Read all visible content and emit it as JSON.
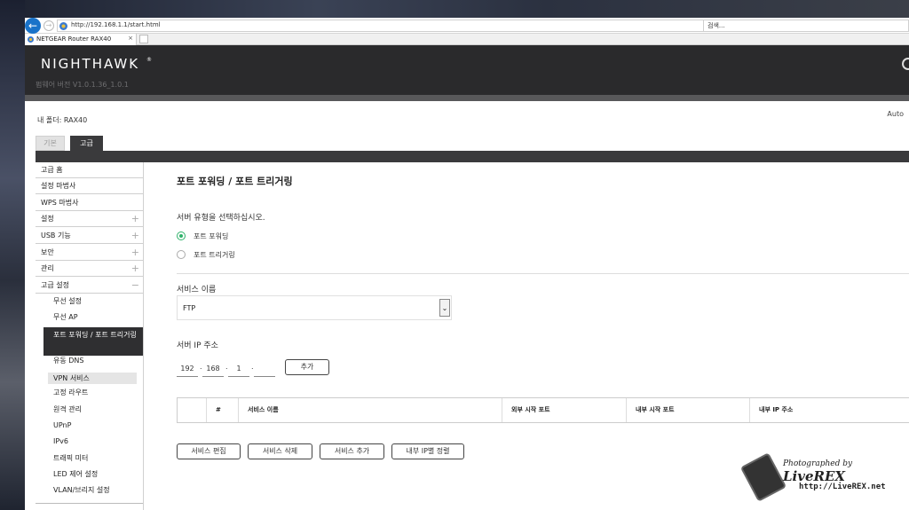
{
  "browser": {
    "url": "http://192.168.1.1/start.html",
    "url_tools": "▾ ↻",
    "search_placeholder": "검색...",
    "tab_title": "NETGEAR Router RAX40",
    "tab_close": "×",
    "back_icon": "←",
    "forward_icon": "→"
  },
  "header": {
    "logo": "NIGHTHAWK",
    "logo_mark": "®",
    "firmware": "펌웨어 버전 V1.0.1.36_1.0.1"
  },
  "page": {
    "my_folder": "내 폴더: RAX40",
    "auto": "Auto",
    "tab_basic": "기본",
    "tab_advanced": "고급"
  },
  "sidebar": {
    "items": [
      {
        "label": "고급 홈",
        "expand": ""
      },
      {
        "label": "설정 마법사",
        "expand": ""
      },
      {
        "label": "WPS 마법사",
        "expand": ""
      },
      {
        "label": "설정",
        "expand": "+"
      },
      {
        "label": "USB 기능",
        "expand": "+"
      },
      {
        "label": "보안",
        "expand": "+"
      },
      {
        "label": "관리",
        "expand": "+"
      },
      {
        "label": "고급 설정",
        "expand": "−"
      }
    ],
    "sub_items": [
      {
        "label": "무선 설정"
      },
      {
        "label": "무선 AP"
      },
      {
        "label": "포트 포워딩 / 포트 트리거링"
      },
      {
        "label": "유동 DNS"
      },
      {
        "label": "VPN 서비스"
      },
      {
        "label": "고정 라우트"
      },
      {
        "label": "원격 관리"
      },
      {
        "label": "UPnP"
      },
      {
        "label": "IPv6"
      },
      {
        "label": "트래픽 미터"
      },
      {
        "label": "LED 제어 설정"
      },
      {
        "label": "VLAN/브리지 설정"
      }
    ]
  },
  "main": {
    "title": "포트 포워딩 / 포트 트리거링",
    "server_type_label": "서버 유형을 선택하십시오.",
    "radio_port_forwarding": "포트 포워딩",
    "radio_port_triggering": "포트 트리거링",
    "service_name_label": "서비스 이름",
    "service_name_value": "FTP",
    "server_ip_label": "서버 IP 주소",
    "ip": [
      "192",
      "168",
      "1",
      ""
    ],
    "add_button": "추가",
    "table_headers": [
      "",
      "#",
      "서비스 이름",
      "외부 시작 포트",
      "내부 시작 포트",
      "내부 IP 주소"
    ],
    "buttons": {
      "edit": "서비스 편집",
      "delete": "서비스 삭제",
      "add": "서비스 추가",
      "sort": "내부 IP별 정렬"
    }
  },
  "watermark": {
    "line1": "Photographed by",
    "line1_brand": "LiveREX",
    "line2": "http://LiveREX.net"
  }
}
